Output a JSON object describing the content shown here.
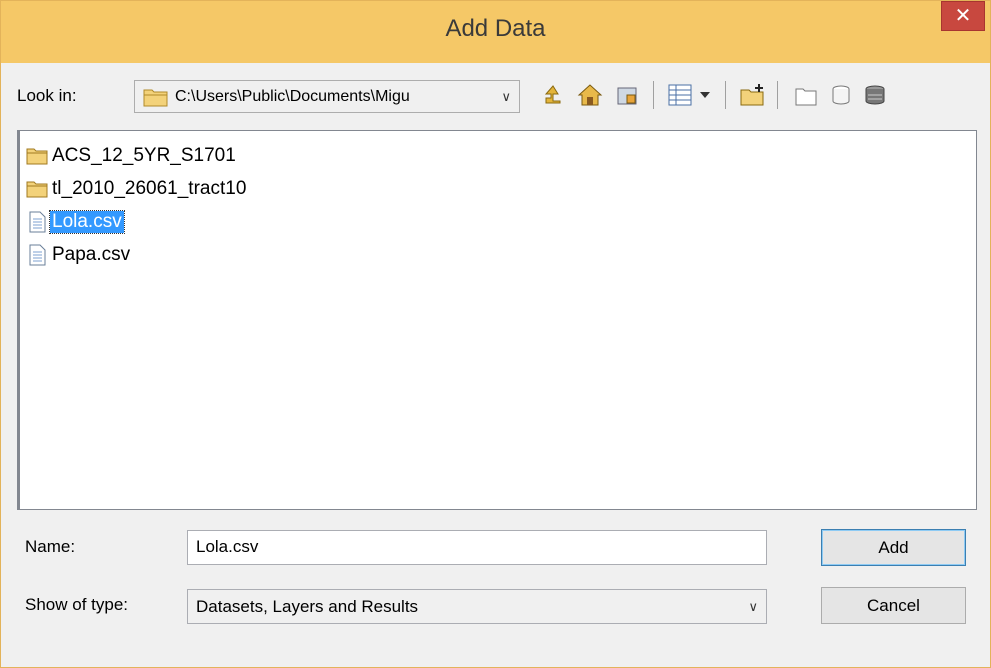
{
  "window": {
    "title": "Add Data",
    "close_glyph": "✕"
  },
  "lookin": {
    "label": "Look in:",
    "path": "C:\\Users\\Public\\Documents\\Migu",
    "arrow": "∨"
  },
  "toolbar": {
    "icons": [
      "up-one-level-icon",
      "home-icon",
      "connect-folder-icon",
      "view-details-icon",
      "new-folder-icon",
      "new-shapefile-icon",
      "new-database-icon",
      "new-feature-class-icon"
    ]
  },
  "files": [
    {
      "name": "ACS_12_5YR_S1701",
      "kind": "folder",
      "selected": false
    },
    {
      "name": "tl_2010_26061_tract10",
      "kind": "folder",
      "selected": false
    },
    {
      "name": "Lola.csv",
      "kind": "file",
      "selected": true
    },
    {
      "name": "Papa.csv",
      "kind": "file",
      "selected": false
    }
  ],
  "name_field": {
    "label": "Name:",
    "value": "Lola.csv"
  },
  "type_field": {
    "label": "Show of type:",
    "value": "Datasets, Layers and Results",
    "arrow": "∨"
  },
  "buttons": {
    "add": "Add",
    "cancel": "Cancel"
  },
  "colors": {
    "title_bar": "#f5c867",
    "close": "#c8483f",
    "selection": "#3399ff"
  }
}
